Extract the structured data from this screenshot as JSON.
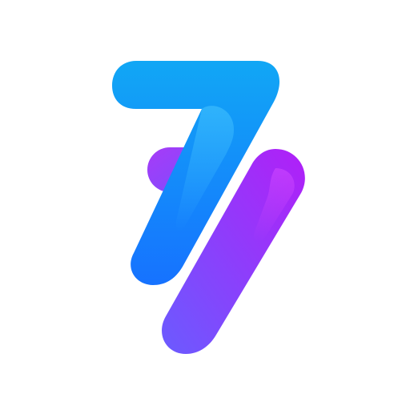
{
  "logo": {
    "name": "stylized-seven-slash-logo",
    "colors": {
      "background": "#FFFFFF",
      "seven_top": "#11A7F5",
      "seven_bottom": "#1672FF",
      "seven_highlight": "#47C5FF",
      "slash_top": "#B11FF7",
      "slash_bottom": "#6B5BFF",
      "slash_highlight": "#D24BFF",
      "tab_top": "#A73BF7",
      "tab_bottom": "#7A4DFF"
    }
  }
}
